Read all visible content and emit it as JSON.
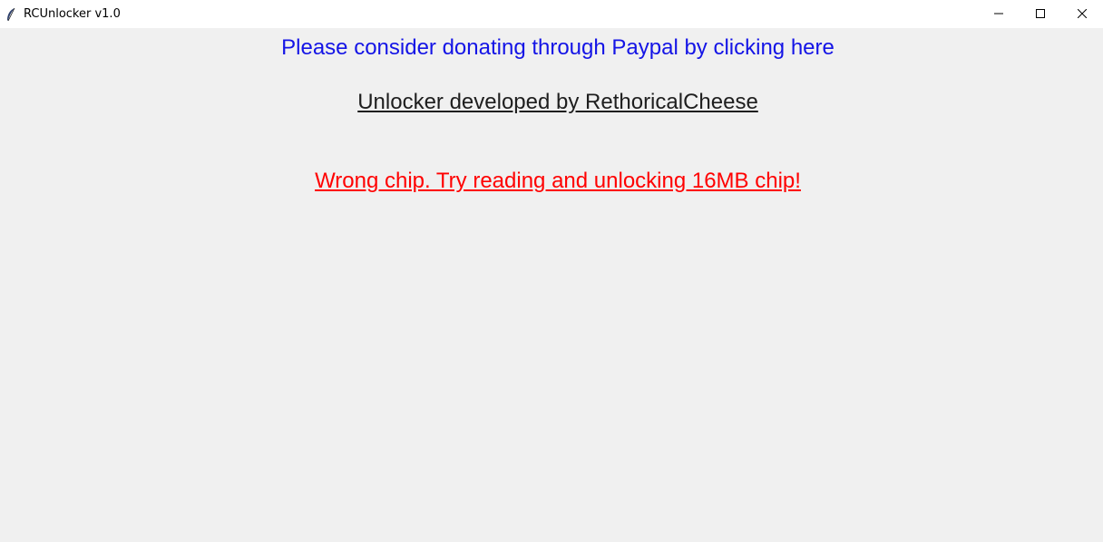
{
  "window": {
    "title": "RCUnlocker v1.0",
    "app_icon": "feather-icon",
    "controls": {
      "minimize_icon": "minimize-icon",
      "maximize_icon": "maximize-icon",
      "close_icon": "close-icon"
    }
  },
  "main": {
    "donate_text": "Please consider donating through Paypal by clicking here",
    "developer_text": "Unlocker developed by RethoricalCheese",
    "status_text": "Wrong chip. Try reading and unlocking 16MB chip!"
  },
  "colors": {
    "link": "#1414e6",
    "text": "#1e1e1e",
    "error": "#ff0000",
    "background": "#f0f0f0"
  }
}
